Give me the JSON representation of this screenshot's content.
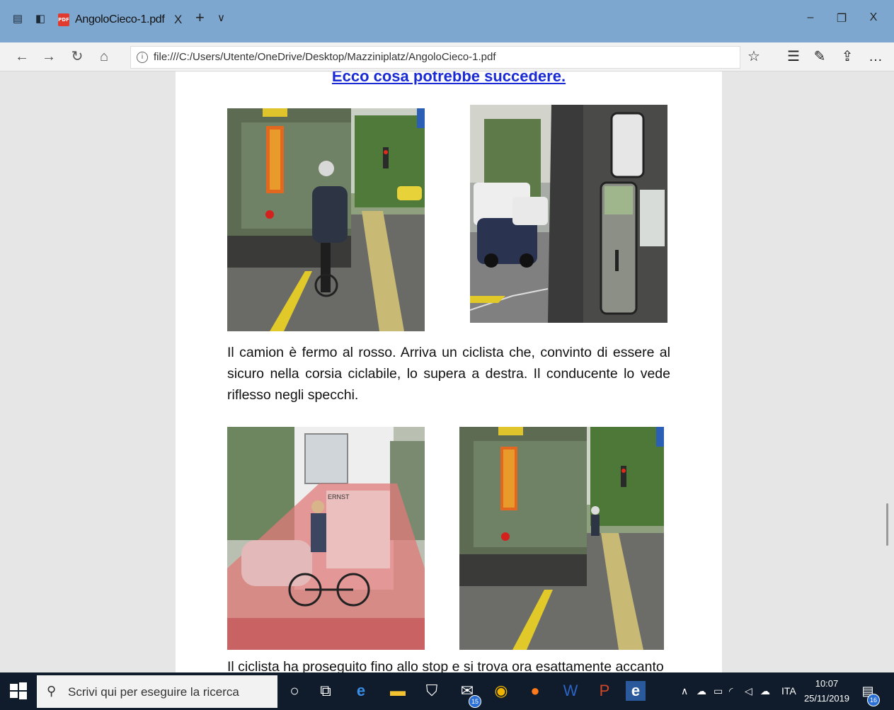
{
  "browser": {
    "tab_title": "AngoloCieco-1.pdf",
    "tab_close": "X",
    "new_tab": "+",
    "tab_menu": "∨",
    "url": "file:///C:/Users/Utente/OneDrive/Desktop/Mazziniplatz/AngoloCieco-1.pdf",
    "window": {
      "minimize": "–",
      "restore": "❐",
      "close": "X"
    }
  },
  "document": {
    "heading": "Ecco cosa potrebbe succedere.",
    "paragraph1": "Il camion è fermo al rosso. Arriva un ciclista che, convinto di essere al sicuro nella corsia ciclabile, lo supera a destra. Il conducente lo vede riflesso negli specchi.",
    "paragraph2_partial": "Il ciclista ha proseguito fino allo stop e si trova ora esattamente accanto",
    "photo_text_ernst": "ERNST"
  },
  "taskbar": {
    "search_placeholder": "Scrivi qui per eseguire la ricerca",
    "language": "ITA",
    "time": "10:07",
    "date": "25/11/2019",
    "mail_badge": "15",
    "notifications_badge": "16"
  },
  "colors": {
    "titlebar": "#7ea7cf",
    "heading_link": "#1a2bd6",
    "taskbar": "#101c2c"
  }
}
